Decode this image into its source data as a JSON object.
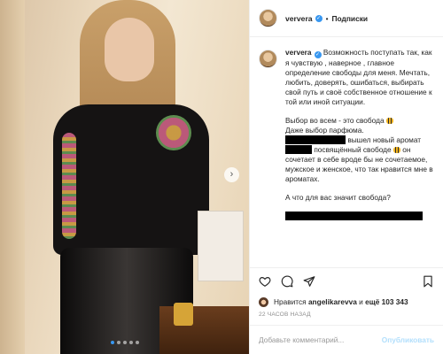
{
  "header": {
    "username": "ververa",
    "separator": "•",
    "follow_label": "Подписки"
  },
  "caption": {
    "username": "ververa",
    "p1": "Возможность поступать так, как я чувствую , наверное , главное определение свободы для меня. Мечтать, любить, доверять, ошибаться, выбирать свой путь и своё собственное отношение к той или иной ситуации.",
    "p2a": "Выбор во всем - это свобода",
    "p2b": "Даже выбор парфюма.",
    "p2c": "вышел новый аромат",
    "p2d": "посвящённый свободе",
    "p2e": "он сочетает в себе вроде бы не сочетаемое, мужское и женское, что так нравится мне в ароматах.",
    "p3": "А что для вас значит свобода?"
  },
  "likes": {
    "prefix": "Нравится",
    "liker": "angelikarevva",
    "middle": "и",
    "count": "ещё 103 343"
  },
  "timestamp": "22 ЧАСОВ НАЗАД",
  "comment_box": {
    "placeholder": "Добавьте комментарий...",
    "publish_label": "Опубликовать"
  },
  "media": {
    "slides": 5,
    "active_slide": 1
  },
  "colors": {
    "verified": "#3897f0",
    "publish_disabled": "#b2dffc",
    "muted": "#8e8e8e"
  },
  "icons": [
    "heart-icon",
    "comment-icon",
    "share-icon",
    "bookmark-icon",
    "chevron-right-icon",
    "verified-icon"
  ]
}
